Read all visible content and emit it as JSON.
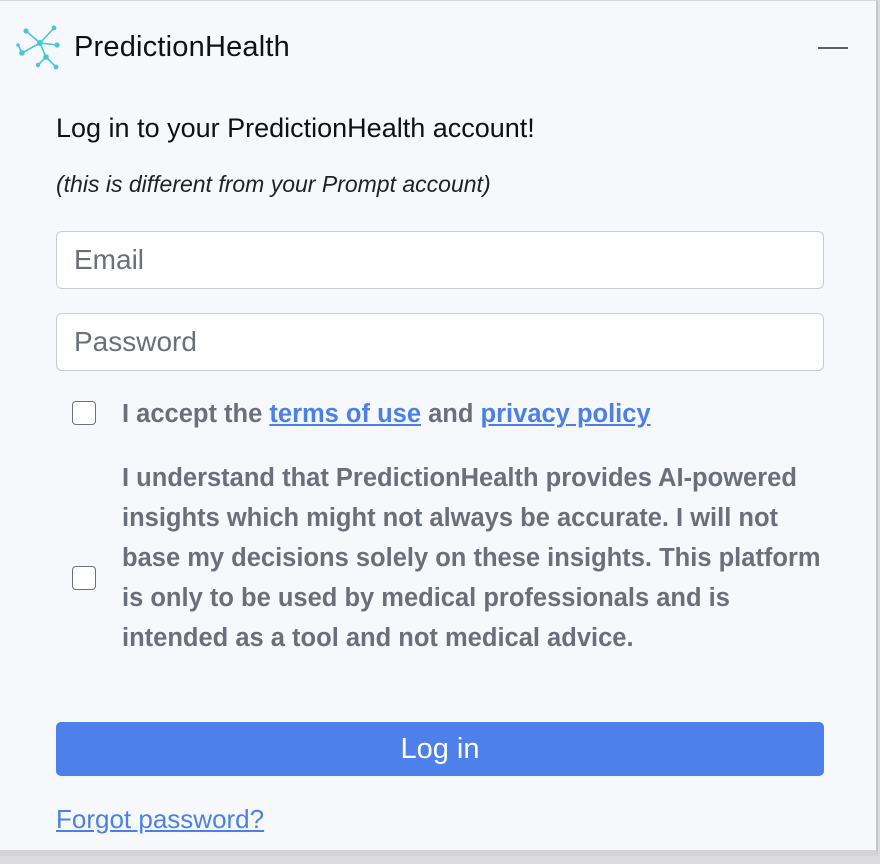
{
  "header": {
    "brand": "PredictionHealth",
    "logo_icon": "network-nodes-icon",
    "minimize_icon": "minimize-icon",
    "accent_color": "#4ac6dc"
  },
  "form": {
    "heading": "Log in to your PredictionHealth account!",
    "subheading": "(this is different from your Prompt account)",
    "email_placeholder": "Email",
    "email_value": "",
    "password_placeholder": "Password",
    "password_value": ""
  },
  "terms": {
    "checked": false,
    "prefix": "I accept the ",
    "terms_link": "terms of use",
    "middle": " and ",
    "privacy_link": "privacy policy"
  },
  "disclaimer": {
    "checked": false,
    "text": "I understand that PredictionHealth provides AI-powered insights which might not always be accurate. I will not base my decisions solely on these insights. This platform is only to be used by medical professionals and is intended as a tool and not medical advice."
  },
  "actions": {
    "login_label": "Log in",
    "login_color": "#4d80ea",
    "forgot_password": "Forgot password?",
    "link_color": "#4a80e8"
  }
}
